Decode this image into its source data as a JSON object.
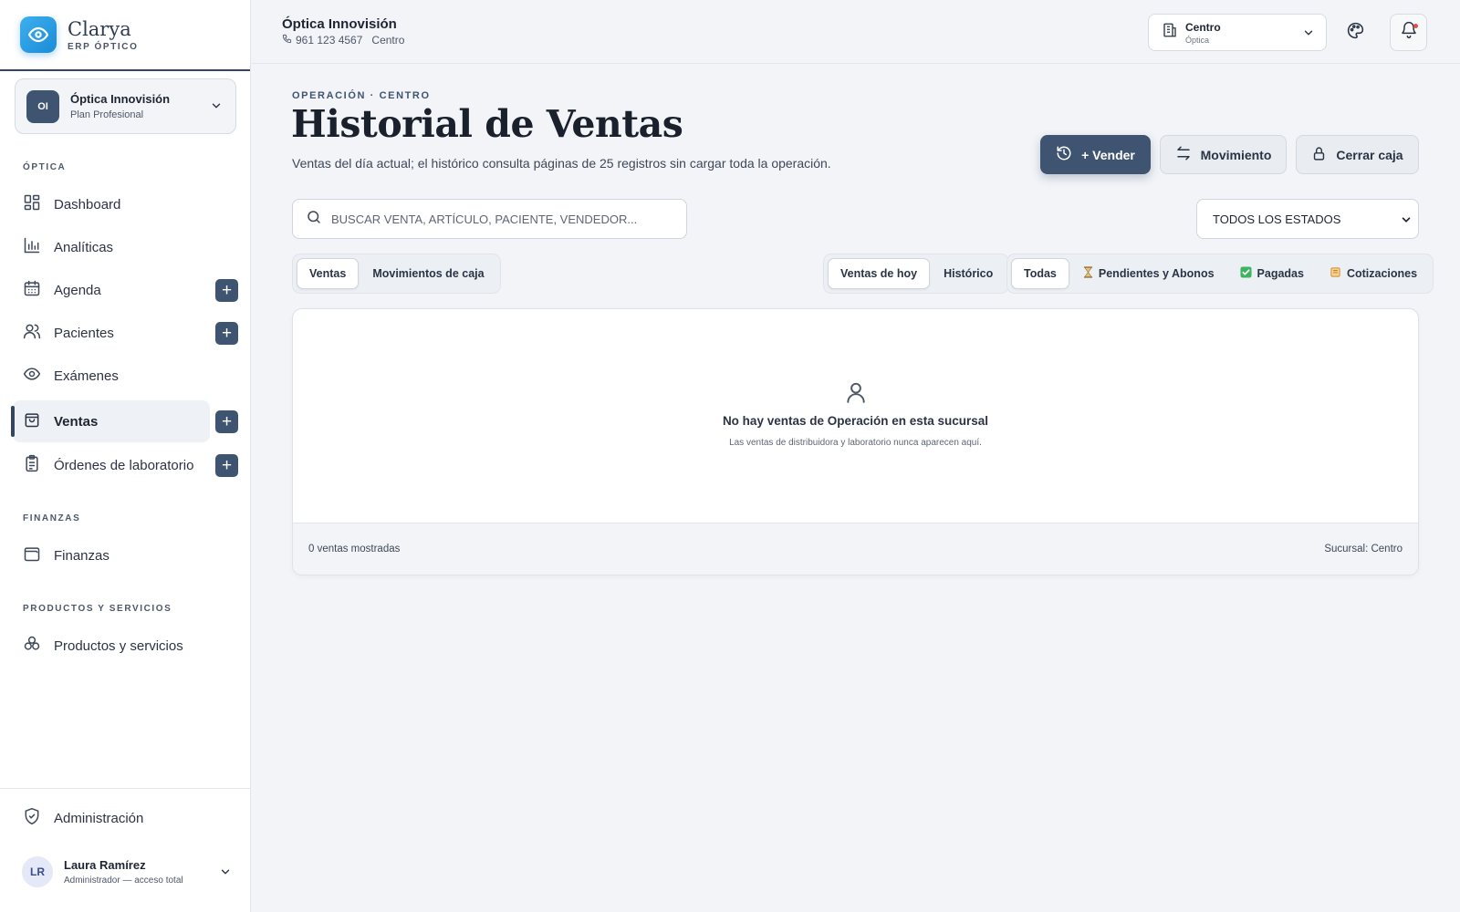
{
  "brand": {
    "name": "Clarya",
    "subtitle": "ERP ÓPTICO"
  },
  "org": {
    "initials": "OI",
    "name": "Óptica Innovisión",
    "plan": "Plan Profesional"
  },
  "sidebar": {
    "sections": [
      {
        "label": "ÓPTICA"
      },
      {
        "label": "FINANZAS"
      },
      {
        "label": "PRODUCTOS Y SERVICIOS"
      }
    ],
    "items": [
      {
        "label": "Dashboard",
        "icon": "dashboard-icon"
      },
      {
        "label": "Analíticas",
        "icon": "chart-icon"
      },
      {
        "label": "Agenda",
        "icon": "calendar-icon",
        "plus": true
      },
      {
        "label": "Pacientes",
        "icon": "users-icon",
        "plus": true
      },
      {
        "label": "Exámenes",
        "icon": "eye-icon"
      },
      {
        "label": "Ventas",
        "icon": "shopping-bag-icon",
        "plus": true,
        "active": true
      },
      {
        "label": "Órdenes de laboratorio",
        "icon": "clipboard-icon",
        "plus": true
      },
      {
        "label": "Finanzas",
        "icon": "wallet-icon"
      },
      {
        "label": "Productos y servicios",
        "icon": "boxes-icon"
      }
    ],
    "admin": {
      "label": "Administración",
      "icon": "shield-icon"
    },
    "user": {
      "initials": "LR",
      "name": "Laura Ramírez",
      "role": "Administrador — acceso total"
    }
  },
  "topbar": {
    "title": "Óptica Innovisión",
    "phone": "961 123 4567",
    "location": "Centro",
    "branch": {
      "name": "Centro",
      "type": "Óptica"
    }
  },
  "main": {
    "eyebrow": "OPERACIÓN · CENTRO",
    "title": "Historial de Ventas",
    "description": "Ventas del día actual; el histórico consulta páginas de 25 registros sin cargar toda la operación.",
    "buttons": {
      "vender": "+ Vender",
      "movimiento": "Movimiento",
      "cerrar": "Cerrar caja"
    },
    "search": {
      "placeholder": "BUSCAR VENTA, ARTÍCULO, PACIENTE, VENDEDOR...",
      "value": ""
    },
    "status_filter": "TODOS LOS ESTADOS",
    "tabs_left": [
      {
        "label": "Ventas",
        "selected": true
      },
      {
        "label": "Movimientos de caja",
        "selected": false
      }
    ],
    "tabs_mid": [
      {
        "label": "Ventas de hoy",
        "selected": true
      },
      {
        "label": "Histórico",
        "selected": false
      }
    ],
    "tabs_right": [
      {
        "label": "Todas",
        "selected": true
      },
      {
        "label": "Pendientes y Abonos",
        "emoji": "⏳"
      },
      {
        "label": "Pagadas",
        "emoji": "✅"
      },
      {
        "label": "Cotizaciones",
        "emoji": "📜"
      }
    ],
    "empty": {
      "title": "No hay ventas de Operación en esta sucursal",
      "subtitle": "Las ventas de distribuidora y laboratorio nunca aparecen aquí."
    },
    "footer": {
      "count": "0 ventas mostradas",
      "branch": "Sucursal: Centro"
    }
  },
  "colors": {
    "accent": "#3e5470",
    "brand_blue": "#1a8bd6",
    "background": "#f2f4f7"
  }
}
